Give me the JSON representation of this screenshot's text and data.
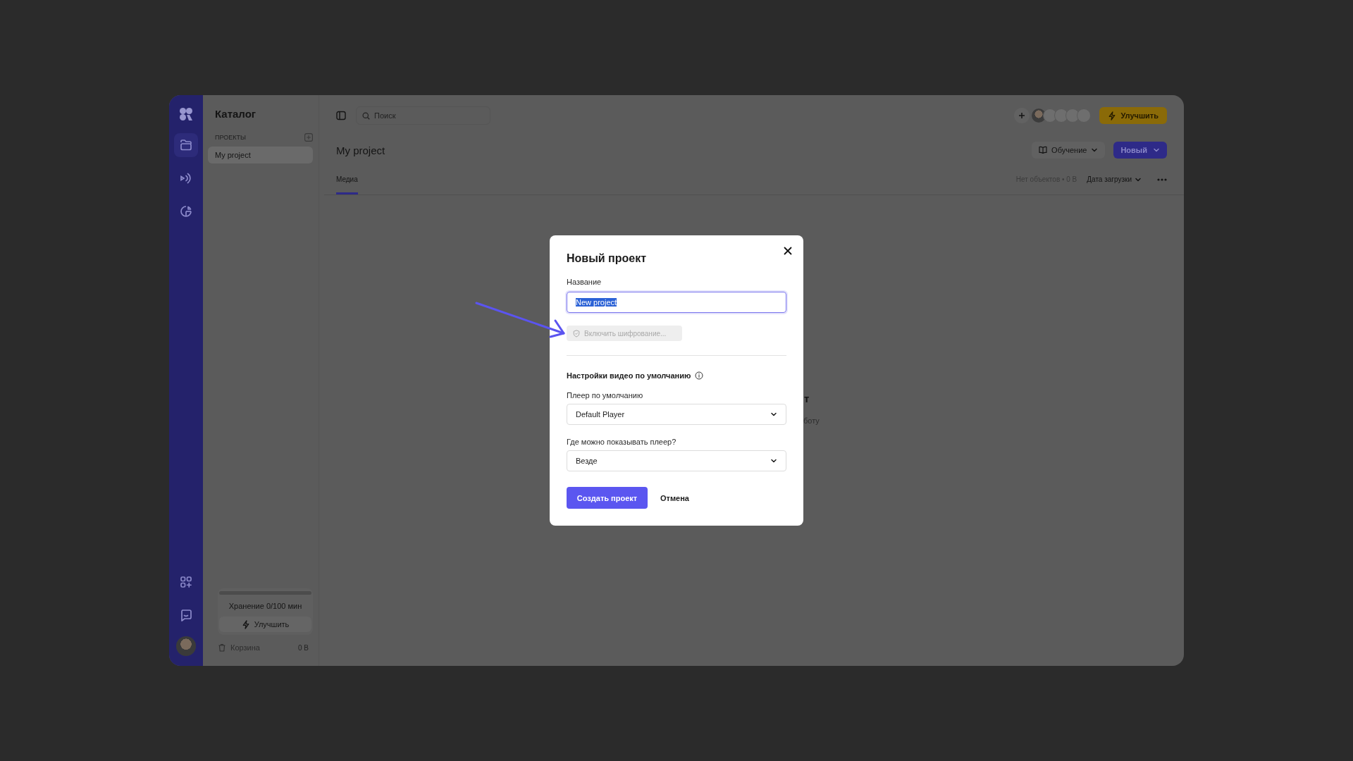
{
  "rail": {
    "nav": [
      {
        "kind": "folder",
        "selected": true
      },
      {
        "kind": "broadcast",
        "selected": false
      },
      {
        "kind": "chart",
        "selected": false
      }
    ],
    "bottom": [
      {
        "kind": "apps"
      },
      {
        "kind": "chat"
      }
    ]
  },
  "sidebar": {
    "title": "Каталог",
    "section_label": "ПРОЕКТЫ",
    "projects": [
      {
        "name": "My project",
        "selected": true
      }
    ],
    "storage": {
      "level": 0,
      "label": "Хранение 0/100 мин"
    },
    "upgrade_button": "Улучшить",
    "trash": {
      "label": "Корзина",
      "size": "0 B"
    }
  },
  "topbar": {
    "search": {
      "placeholder": "Поиск"
    },
    "upgrade_button": "Улучшить"
  },
  "header": {
    "title": "My project",
    "learn_button": "Обучение",
    "new_button": "Новый"
  },
  "tabs": [
    {
      "label": "Медиа",
      "selected": true
    }
  ],
  "toolbar": {
    "count": "Нет объектов • 0 B",
    "sort": "Дата загрузки"
  },
  "empty_state": {
    "title_fragment": "т",
    "text_fragment": "боту"
  },
  "dialog": {
    "title": "Новый проект",
    "name_field": {
      "label": "Название",
      "value": "New project",
      "text_selected": true
    },
    "encryption_button": {
      "label": "Включить шифрование...",
      "disabled": true
    },
    "section_title": "Настройки видео по умолчанию",
    "selects": [
      {
        "label": "Плеер по умолчанию",
        "value": "Default Player"
      },
      {
        "label": "Где можно показывать плеер?",
        "value": "Везде"
      }
    ],
    "primary_button": "Создать проект",
    "cancel_button": "Отмена"
  }
}
